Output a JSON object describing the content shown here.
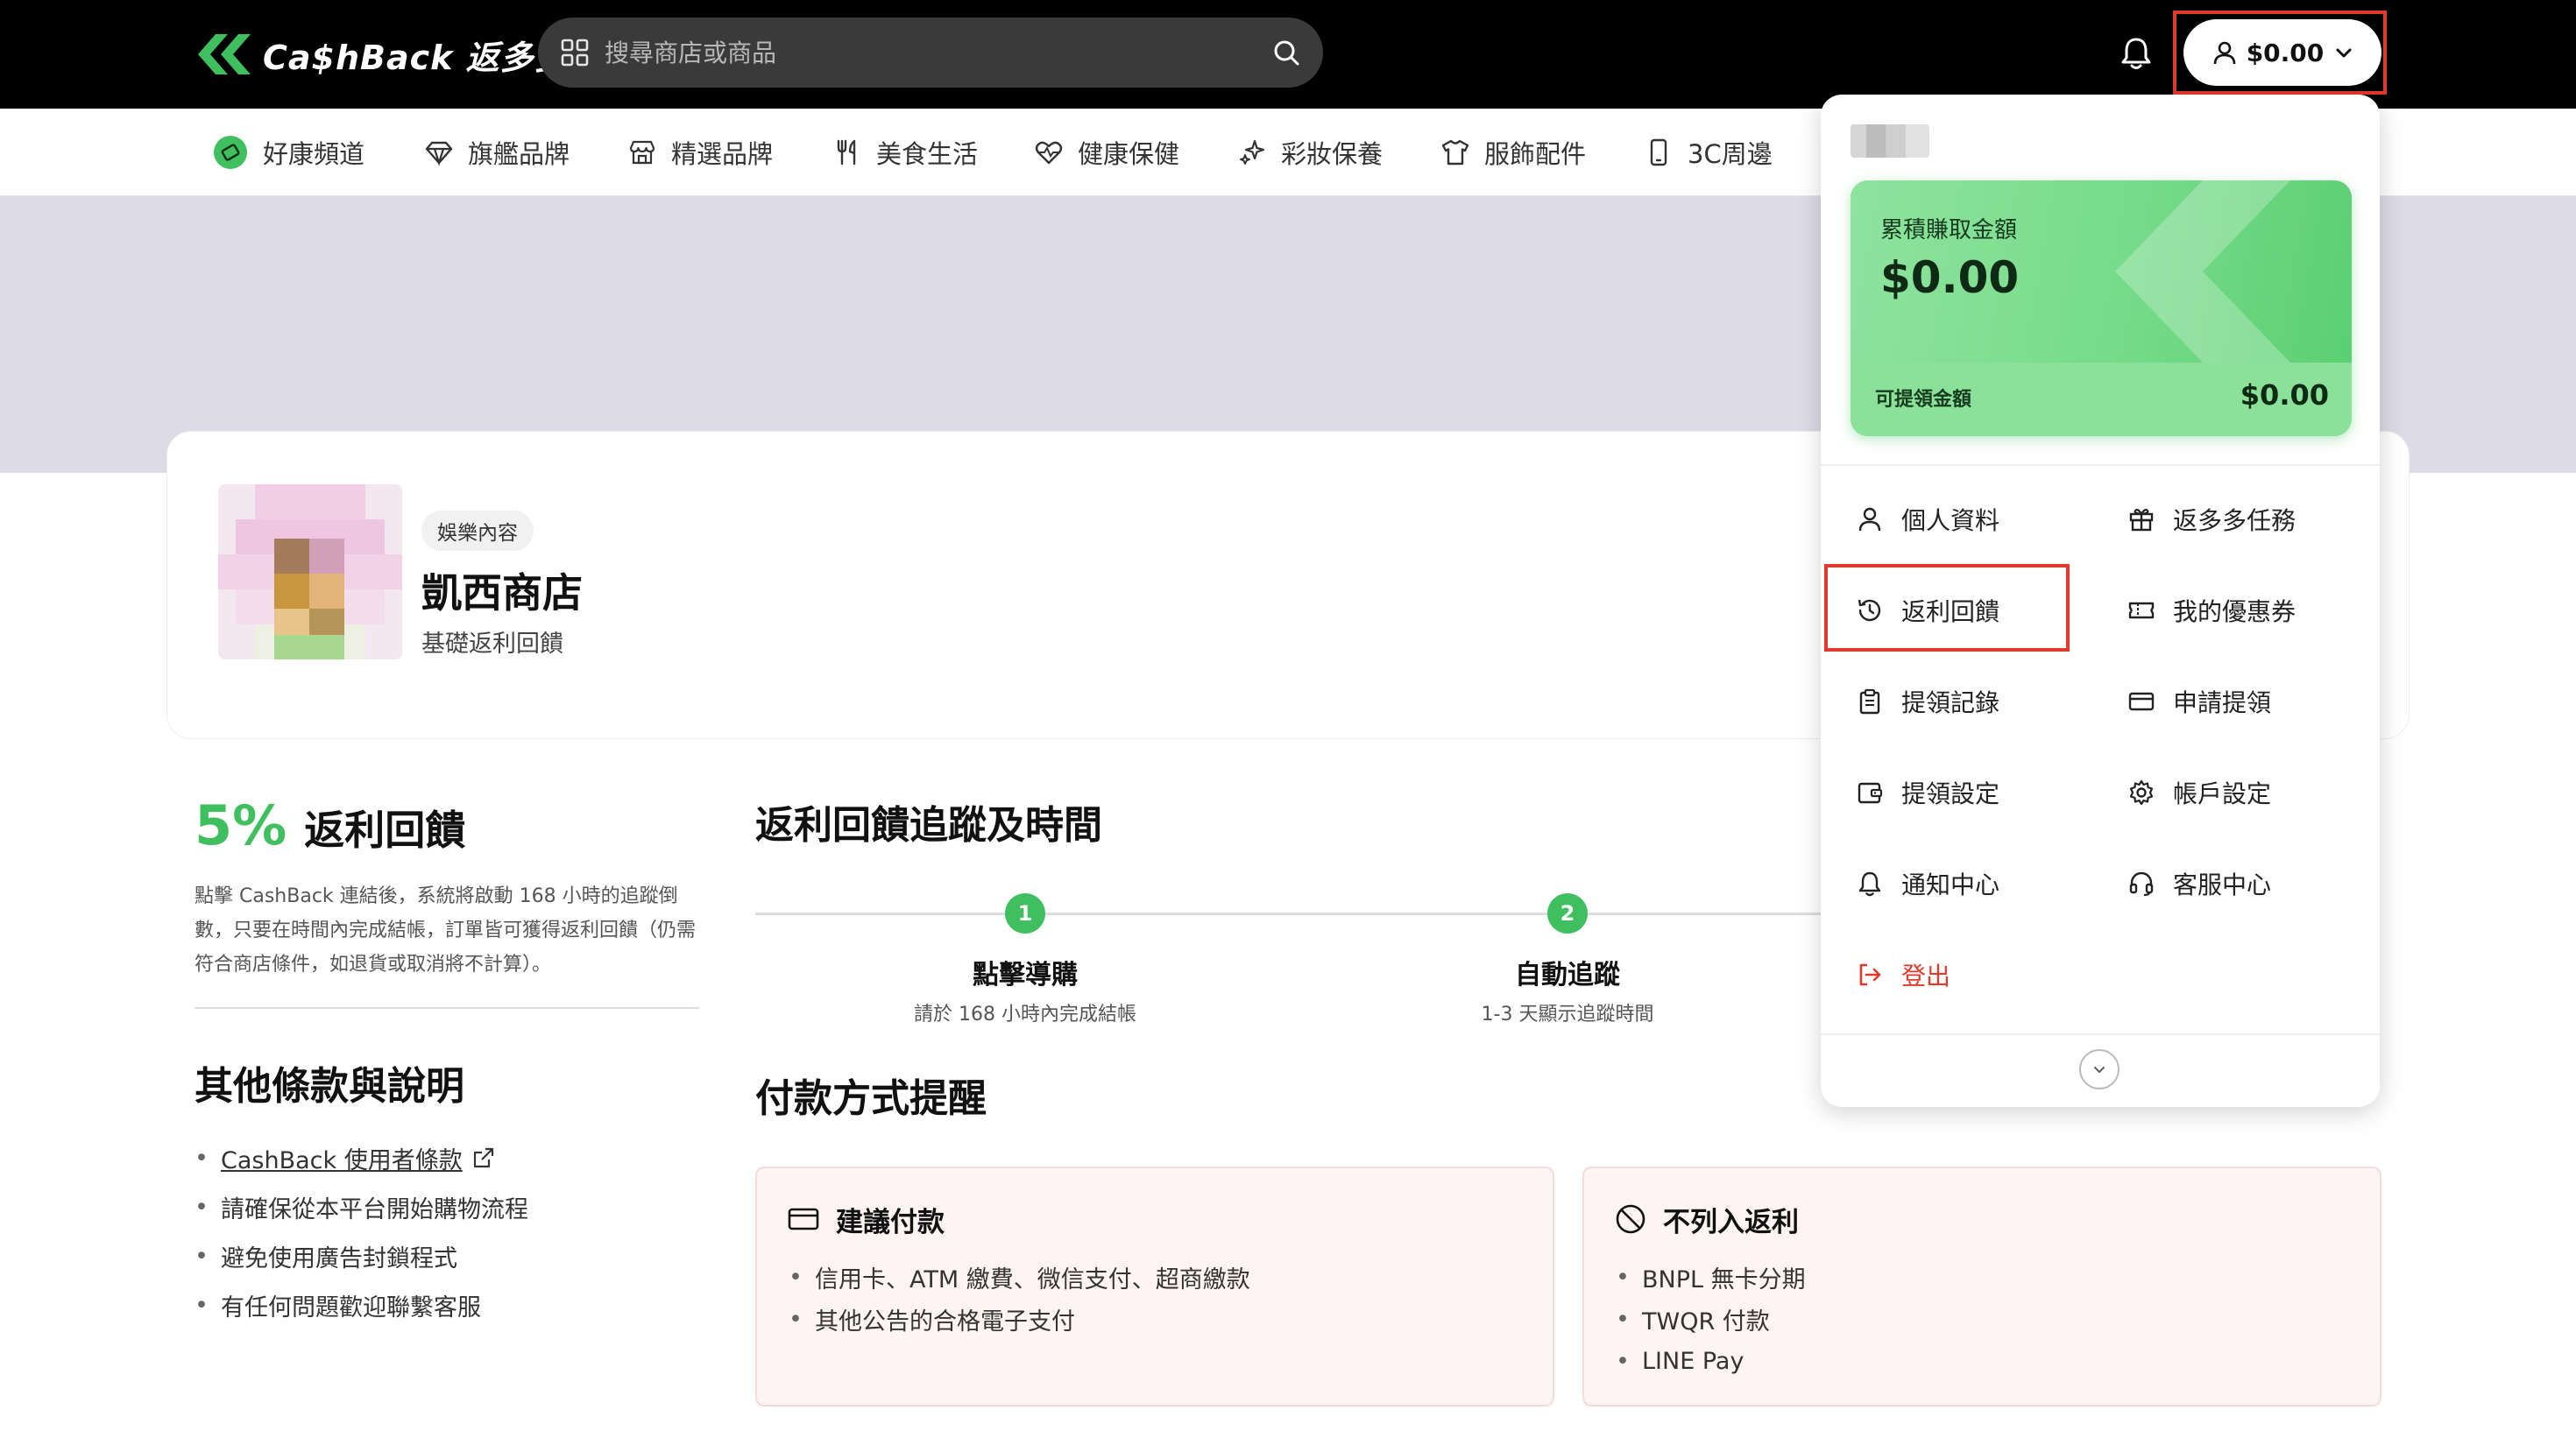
{
  "brand": {
    "logo_text": "Ca$hBack 返多多",
    "accent_color": "#3fbf5e"
  },
  "header": {
    "search_placeholder": "搜尋商店或商品",
    "account_balance": "$0.00"
  },
  "categories": [
    {
      "label": "好康頻道",
      "icon": "coupon-badge-icon"
    },
    {
      "label": "旗艦品牌",
      "icon": "diamond-icon"
    },
    {
      "label": "精選品牌",
      "icon": "store-icon"
    },
    {
      "label": "美食生活",
      "icon": "cutlery-icon"
    },
    {
      "label": "健康保健",
      "icon": "heart-pulse-icon"
    },
    {
      "label": "彩妝保養",
      "icon": "sparkle-icon"
    },
    {
      "label": "服飾配件",
      "icon": "shirt-icon"
    },
    {
      "label": "3C周邊",
      "icon": "phone-icon"
    }
  ],
  "store": {
    "tag": "娛樂內容",
    "name": "凱西商店",
    "subtitle": "基礎返利回饋"
  },
  "cashback": {
    "rate": "5%",
    "rate_label": "返利回饋",
    "description": "點擊 CashBack 連結後，系統將啟動 168 小時的追蹤倒數，只要在時間內完成結帳，訂單皆可獲得返利回饋（仍需符合商店條件，如退貨或取消將不計算）。"
  },
  "terms": {
    "title": "其他條款與說明",
    "items": [
      "CashBack 使用者條款",
      "請確保從本平台開始購物流程",
      "避免使用廣告封鎖程式",
      "有任何問題歡迎聯繫客服"
    ]
  },
  "tracking": {
    "title": "返利回饋追蹤及時間",
    "steps": [
      {
        "num": "1",
        "title": "點擊導購",
        "sub": "請於 168 小時內完成結帳"
      },
      {
        "num": "2",
        "title": "自動追蹤",
        "sub": "1-3 天顯示追蹤時間"
      }
    ]
  },
  "payment": {
    "title": "付款方式提醒",
    "suggested": {
      "title": "建議付款",
      "items": [
        "信用卡、ATM 繳費、微信支付、超商繳款",
        "其他公告的合格電子支付"
      ]
    },
    "excluded": {
      "title": "不列入返利",
      "items": [
        "BNPL 無卡分期",
        "TWQR 付款",
        "LINE Pay"
      ]
    }
  },
  "dropdown": {
    "earn_label": "累積賺取金額",
    "earn_value": "$0.00",
    "withdraw_label": "可提領金額",
    "withdraw_value": "$0.00",
    "menu": [
      {
        "label": "個人資料",
        "icon": "user-icon"
      },
      {
        "label": "返多多任務",
        "icon": "gift-icon"
      },
      {
        "label": "返利回饋",
        "icon": "history-icon"
      },
      {
        "label": "我的優惠券",
        "icon": "ticket-icon"
      },
      {
        "label": "提領記錄",
        "icon": "clipboard-icon"
      },
      {
        "label": "申請提領",
        "icon": "card-icon"
      },
      {
        "label": "提領設定",
        "icon": "wallet-icon"
      },
      {
        "label": "帳戶設定",
        "icon": "gear-icon"
      },
      {
        "label": "通知中心",
        "icon": "bell-icon"
      },
      {
        "label": "客服中心",
        "icon": "headset-icon"
      }
    ],
    "logout_label": "登出",
    "highlight_color": "#e23a2a"
  }
}
